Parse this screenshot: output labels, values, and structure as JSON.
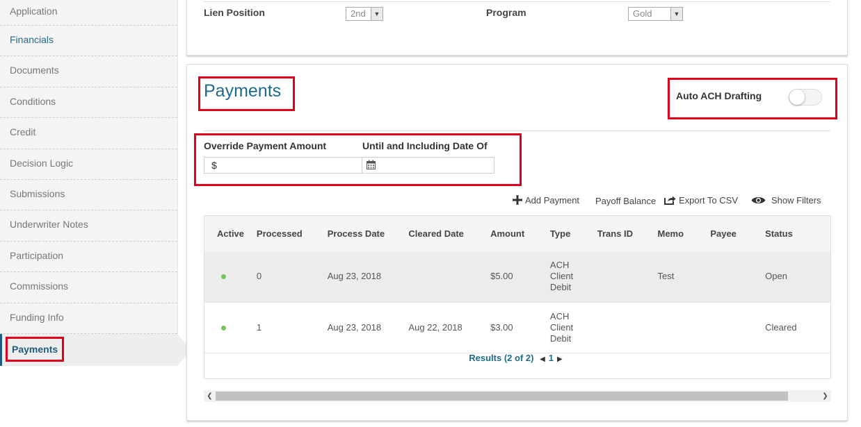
{
  "sidebar": {
    "items": [
      {
        "label": "Application"
      },
      {
        "label": "Financials"
      },
      {
        "label": "Documents"
      },
      {
        "label": "Conditions"
      },
      {
        "label": "Credit"
      },
      {
        "label": "Decision Logic"
      },
      {
        "label": "Submissions"
      },
      {
        "label": "Underwriter Notes"
      },
      {
        "label": "Participation"
      },
      {
        "label": "Commissions"
      },
      {
        "label": "Funding Info"
      },
      {
        "label": "Payments"
      }
    ]
  },
  "top_panel": {
    "lien_label": "Lien Position",
    "lien_value": "2nd",
    "program_label": "Program",
    "program_value": "Gold"
  },
  "payments": {
    "title": "Payments",
    "auto_ach_label": "Auto ACH Drafting",
    "auto_ach_enabled": false,
    "override_label": "Override Payment Amount",
    "override_prefix": "$",
    "override_value": "",
    "until_label": "Until and Including Date Of",
    "until_value": "",
    "actions": {
      "add": "Add Payment",
      "payoff": "Payoff Balance",
      "export": "Export To CSV",
      "filters": "Show Filters"
    },
    "table": {
      "headers": [
        "Active",
        "Processed",
        "Process Date",
        "Cleared Date",
        "Amount",
        "Type",
        "Trans ID",
        "Memo",
        "Payee",
        "Status"
      ],
      "rows": [
        {
          "processed": "0",
          "process_date": "Aug 23, 2018",
          "cleared_date": "",
          "amount": "$5.00",
          "type_1": "ACH",
          "type_2": "Client",
          "type_3": "Debit",
          "trans_id": "",
          "memo": "Test",
          "payee": "",
          "status": "Open"
        },
        {
          "processed": "1",
          "process_date": "Aug 23, 2018",
          "cleared_date": "Aug 22, 2018",
          "amount": "$3.00",
          "type_1": "ACH",
          "type_2": "Client",
          "type_3": "Debit",
          "trans_id": "",
          "memo": "",
          "payee": "",
          "status": "Cleared"
        }
      ]
    },
    "pager": {
      "results": "Results (2 of 2)",
      "page": "1"
    }
  },
  "colors": {
    "accent": "#1e6a8d",
    "highlight_box": "#e0001b",
    "active_dot": "#77c25e"
  },
  "icons": {
    "add": "plus-icon",
    "export": "export-icon",
    "filters": "eye-icon",
    "date": "calendar-icon"
  }
}
